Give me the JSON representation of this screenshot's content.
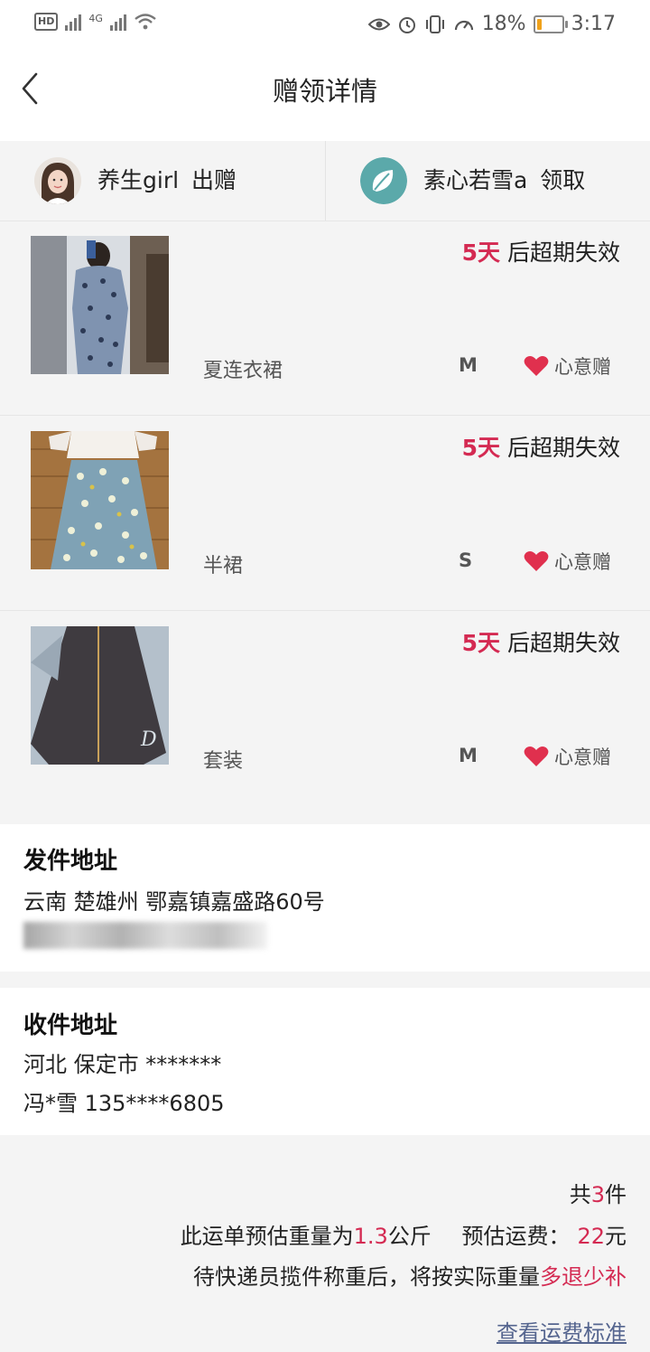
{
  "status_bar": {
    "left_badge": "HD",
    "network_type": "4G",
    "battery_percent": "18%",
    "battery_level": 0.18,
    "time": "3:17"
  },
  "header": {
    "title": "赠领详情",
    "back_icon": "chevron-left-icon"
  },
  "users": {
    "giver": {
      "name": "养生girl",
      "action": "出赠"
    },
    "receiver": {
      "name": "素心若雪a",
      "action": "领取"
    }
  },
  "items": [
    {
      "name": "夏连衣裙",
      "size": "M",
      "days": "5天",
      "expire_text": "后超期失效",
      "gift_label": "心意赠"
    },
    {
      "name": "半裙",
      "size": "S",
      "days": "5天",
      "expire_text": "后超期失效",
      "gift_label": "心意赠"
    },
    {
      "name": "套装",
      "size": "M",
      "days": "5天",
      "expire_text": "后超期失效",
      "gift_label": "心意赠"
    }
  ],
  "send_address": {
    "title": "发件地址",
    "address": "云南 楚雄州 鄂嘉镇嘉盛路60号"
  },
  "recv_address": {
    "title": "收件地址",
    "address": "河北 保定市 *******",
    "contact": "冯*雪 135****6805"
  },
  "summary": {
    "count_prefix": "共",
    "count": "3",
    "count_suffix": "件",
    "weight_prefix": "此运单预估重量为",
    "weight": "1.3",
    "weight_unit": "公斤",
    "fee_label": "预估运费：",
    "fee": "22",
    "fee_unit": "元",
    "note_prefix": "待快递员揽件称重后，将按实际重量",
    "note_highlight": "多退少补",
    "link": "查看运费标准"
  },
  "colors": {
    "accent": "#d42a52",
    "link": "#55658f",
    "heart": "#e0304e"
  }
}
